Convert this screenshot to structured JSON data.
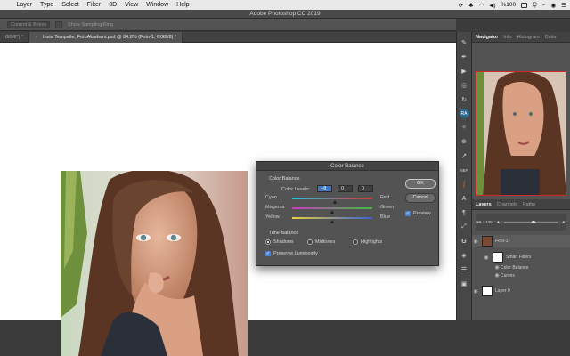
{
  "menubar": {
    "apple": "",
    "items": [
      "Layer",
      "Type",
      "Select",
      "Filter",
      "3D",
      "View",
      "Window",
      "Help"
    ],
    "status_percent": "%100",
    "clock_partial": "Ç"
  },
  "window": {
    "title": "Adobe Photoshop CC 2019"
  },
  "options": {
    "sample_field": "Current & Below",
    "sampling_label": "Show Sampling Ring"
  },
  "tabs": [
    {
      "label": "GB/8*) *"
    },
    {
      "close": "×",
      "label": "Insta Tempalte, FotoAkademi.psd @ 84,8% (Foto-1, RGB/8) *"
    }
  ],
  "right_tools": [
    "brush",
    "pen",
    "play",
    "target",
    "refresh",
    "RA",
    "wand",
    "zoom",
    "feather",
    "NBP",
    "curve",
    "type",
    "paragraph",
    "select",
    "G",
    "layers",
    "fx",
    "spot"
  ],
  "navigator": {
    "tabs": [
      "Navigator",
      "Info",
      "Histogram",
      "Color"
    ],
    "zoom": "84,77%"
  },
  "layers": {
    "tabs": [
      "Layers",
      "Channels",
      "Paths"
    ],
    "rows": [
      {
        "name": "Foto-1"
      },
      {
        "name": "Smart Filters"
      },
      {
        "name": "Color Balance"
      },
      {
        "name": "Curves"
      },
      {
        "name": "Layer 0"
      }
    ]
  },
  "dialog": {
    "title": "Color Balance",
    "group_color_balance": "Color Balance",
    "levels_label": "Color Levels:",
    "levels": [
      "+8",
      "0",
      "0"
    ],
    "sliders": [
      {
        "left": "Cyan",
        "right": "Red",
        "value": 8,
        "color_left": "#2fc6d8",
        "color_right": "#d8323a"
      },
      {
        "left": "Magenta",
        "right": "Green",
        "value": 0,
        "color_left": "#c93bc0",
        "color_right": "#3fbe3f"
      },
      {
        "left": "Yellow",
        "right": "Blue",
        "value": 0,
        "color_left": "#e8d33a",
        "color_right": "#3a5ed8"
      }
    ],
    "group_tone": "Tone Balance",
    "tones": [
      {
        "label": "Shadows",
        "selected": true
      },
      {
        "label": "Midtones",
        "selected": false
      },
      {
        "label": "Highlights",
        "selected": false
      }
    ],
    "preserve_luminosity": "Preserve Luminosity",
    "ok": "OK",
    "cancel": "Cancel",
    "preview": "Preview"
  }
}
